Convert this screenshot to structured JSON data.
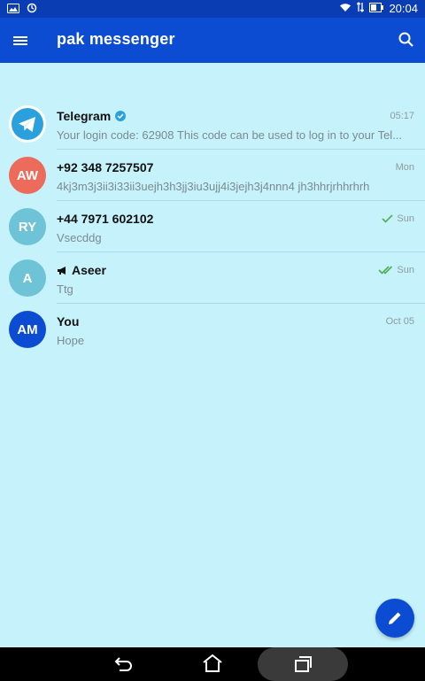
{
  "status_bar": {
    "time": "20:04"
  },
  "app_bar": {
    "title": "pak messenger"
  },
  "chats": [
    {
      "avatar_text": "",
      "avatar_color": "#ffffff",
      "name": "Telegram",
      "verified": true,
      "preview": "Your login code: 62908  This code can be used to log in to your Tel...",
      "time": "05:17",
      "check": "none"
    },
    {
      "avatar_text": "AW",
      "avatar_color": "#ec6b5b",
      "name": "+92 348 7257507",
      "preview": "4kj3m3j3ii3i33ii3uejh3h3jj3iu3ujj4i3jejh3j4nnn4 jh3hhrjrhhrhrh",
      "time": "Mon",
      "check": "none"
    },
    {
      "avatar_text": "RY",
      "avatar_color": "#6ec3d6",
      "name": "+44 7971 602102",
      "preview": "Vsecddg",
      "time": "Sun",
      "check": "single"
    },
    {
      "avatar_text": "A",
      "avatar_color": "#6ec3d6",
      "name": "Aseer",
      "channel": true,
      "preview": "Ttg",
      "time": "Sun",
      "check": "double"
    },
    {
      "avatar_text": "AM",
      "avatar_color": "#0b4cd2",
      "name": "You",
      "preview": "Hope",
      "time": "Oct 05",
      "check": "none"
    }
  ],
  "colors": {
    "accent": "#0b4cd2",
    "background": "#c6f3fb",
    "check": "#4caf50"
  }
}
